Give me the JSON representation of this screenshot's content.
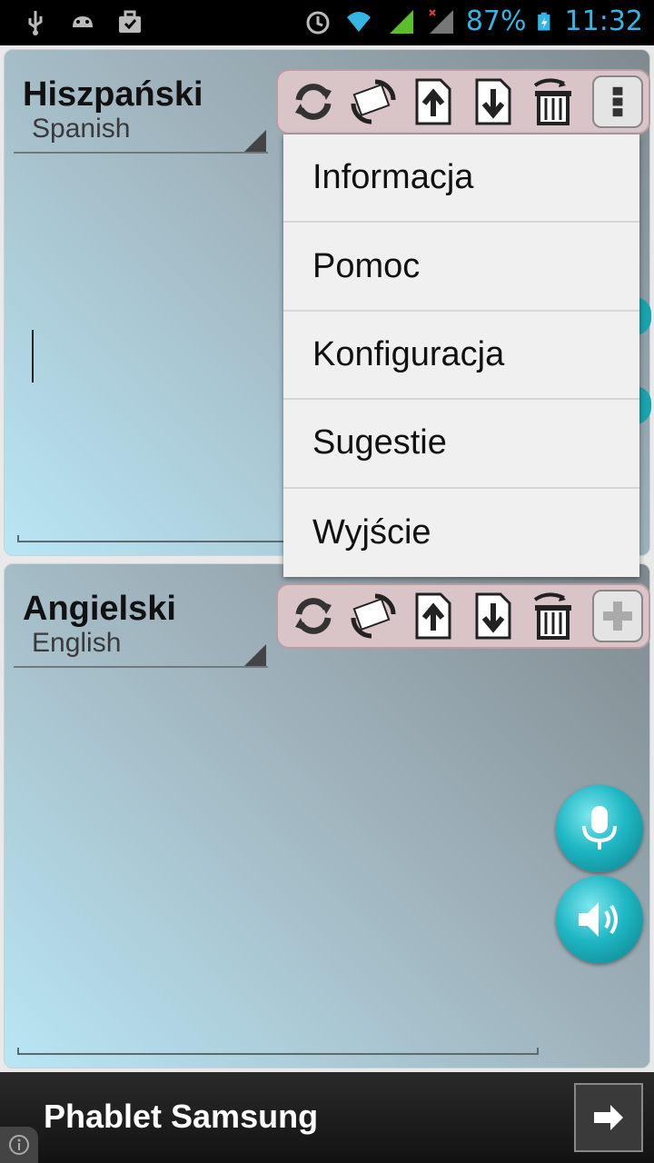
{
  "status_bar": {
    "battery": "87%",
    "time": "11:32",
    "icons": [
      "usb-icon",
      "android-icon",
      "briefcase-icon",
      "alarm-icon",
      "wifi-icon",
      "signal-icon",
      "signal-no-service-icon",
      "battery-charging-icon"
    ]
  },
  "source_panel": {
    "title": "Hiszpański",
    "subtitle": "Spanish"
  },
  "target_panel": {
    "title": "Angielski",
    "subtitle": "English"
  },
  "toolbar_icons": [
    "refresh-icon",
    "swap-translate-icon",
    "upload-icon",
    "download-icon",
    "trash-icon"
  ],
  "overflow_menu": {
    "items": [
      "Informacja",
      "Pomoc",
      "Konfiguracja",
      "Sugestie",
      "Wyjście"
    ]
  },
  "ad_bar": {
    "text": "Phablet Samsung"
  },
  "colors": {
    "accent": "#33b5e5",
    "toolbar_bg": "#d9c5c8",
    "round_button": "#1fb7c4"
  }
}
